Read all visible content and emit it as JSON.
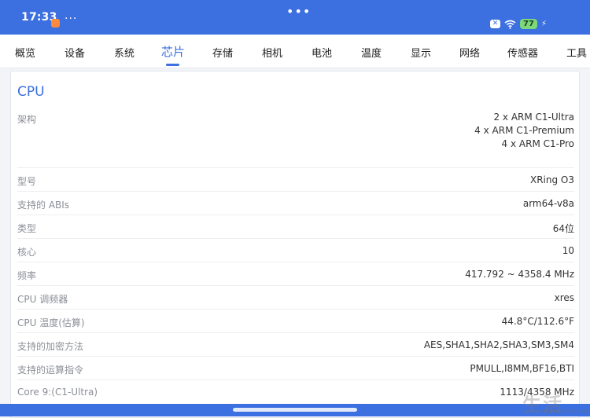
{
  "status_bar": {
    "time": "17:33",
    "battery": "77",
    "colors": {
      "background": "#3c6fe0",
      "battery": "#7cd87a"
    }
  },
  "tabs": [
    {
      "label": "概览"
    },
    {
      "label": "设备"
    },
    {
      "label": "系统"
    },
    {
      "label": "芯片",
      "active": true
    },
    {
      "label": "存储"
    },
    {
      "label": "相机"
    },
    {
      "label": "电池"
    },
    {
      "label": "温度"
    },
    {
      "label": "显示"
    },
    {
      "label": "网络"
    },
    {
      "label": "传感器"
    },
    {
      "label": "工具"
    }
  ],
  "cpu": {
    "title": "CPU",
    "architecture": {
      "label": "架构",
      "values": [
        "2 x ARM C1-Ultra",
        "4 x ARM C1-Premium",
        "4 x ARM C1-Pro"
      ]
    },
    "rows": [
      {
        "label": "型号",
        "value": "XRing O3"
      },
      {
        "label": "支持的 ABIs",
        "value": "arm64-v8a"
      },
      {
        "label": "类型",
        "value": "64位"
      },
      {
        "label": "核心",
        "value": "10"
      },
      {
        "label": "频率",
        "value": "417.792 ~ 4358.4 MHz"
      },
      {
        "label": "CPU 调频器",
        "value": "xres"
      },
      {
        "label": "CPU 温度(估算)",
        "value": "44.8°C/112.6°F"
      },
      {
        "label": "支持的加密方法",
        "value": "AES,SHA1,SHA2,SHA3,SM3,SM4"
      },
      {
        "label": "支持的运算指令",
        "value": "PMULL,I8MM,BF16,BTI"
      },
      {
        "label": "Core 9:(C1-Ultra)",
        "value": "1113/4358 MHz"
      }
    ]
  },
  "watermark": {
    "text": "生活",
    "url": "www.3elife.net"
  },
  "accent_color": "#3c6fe0"
}
